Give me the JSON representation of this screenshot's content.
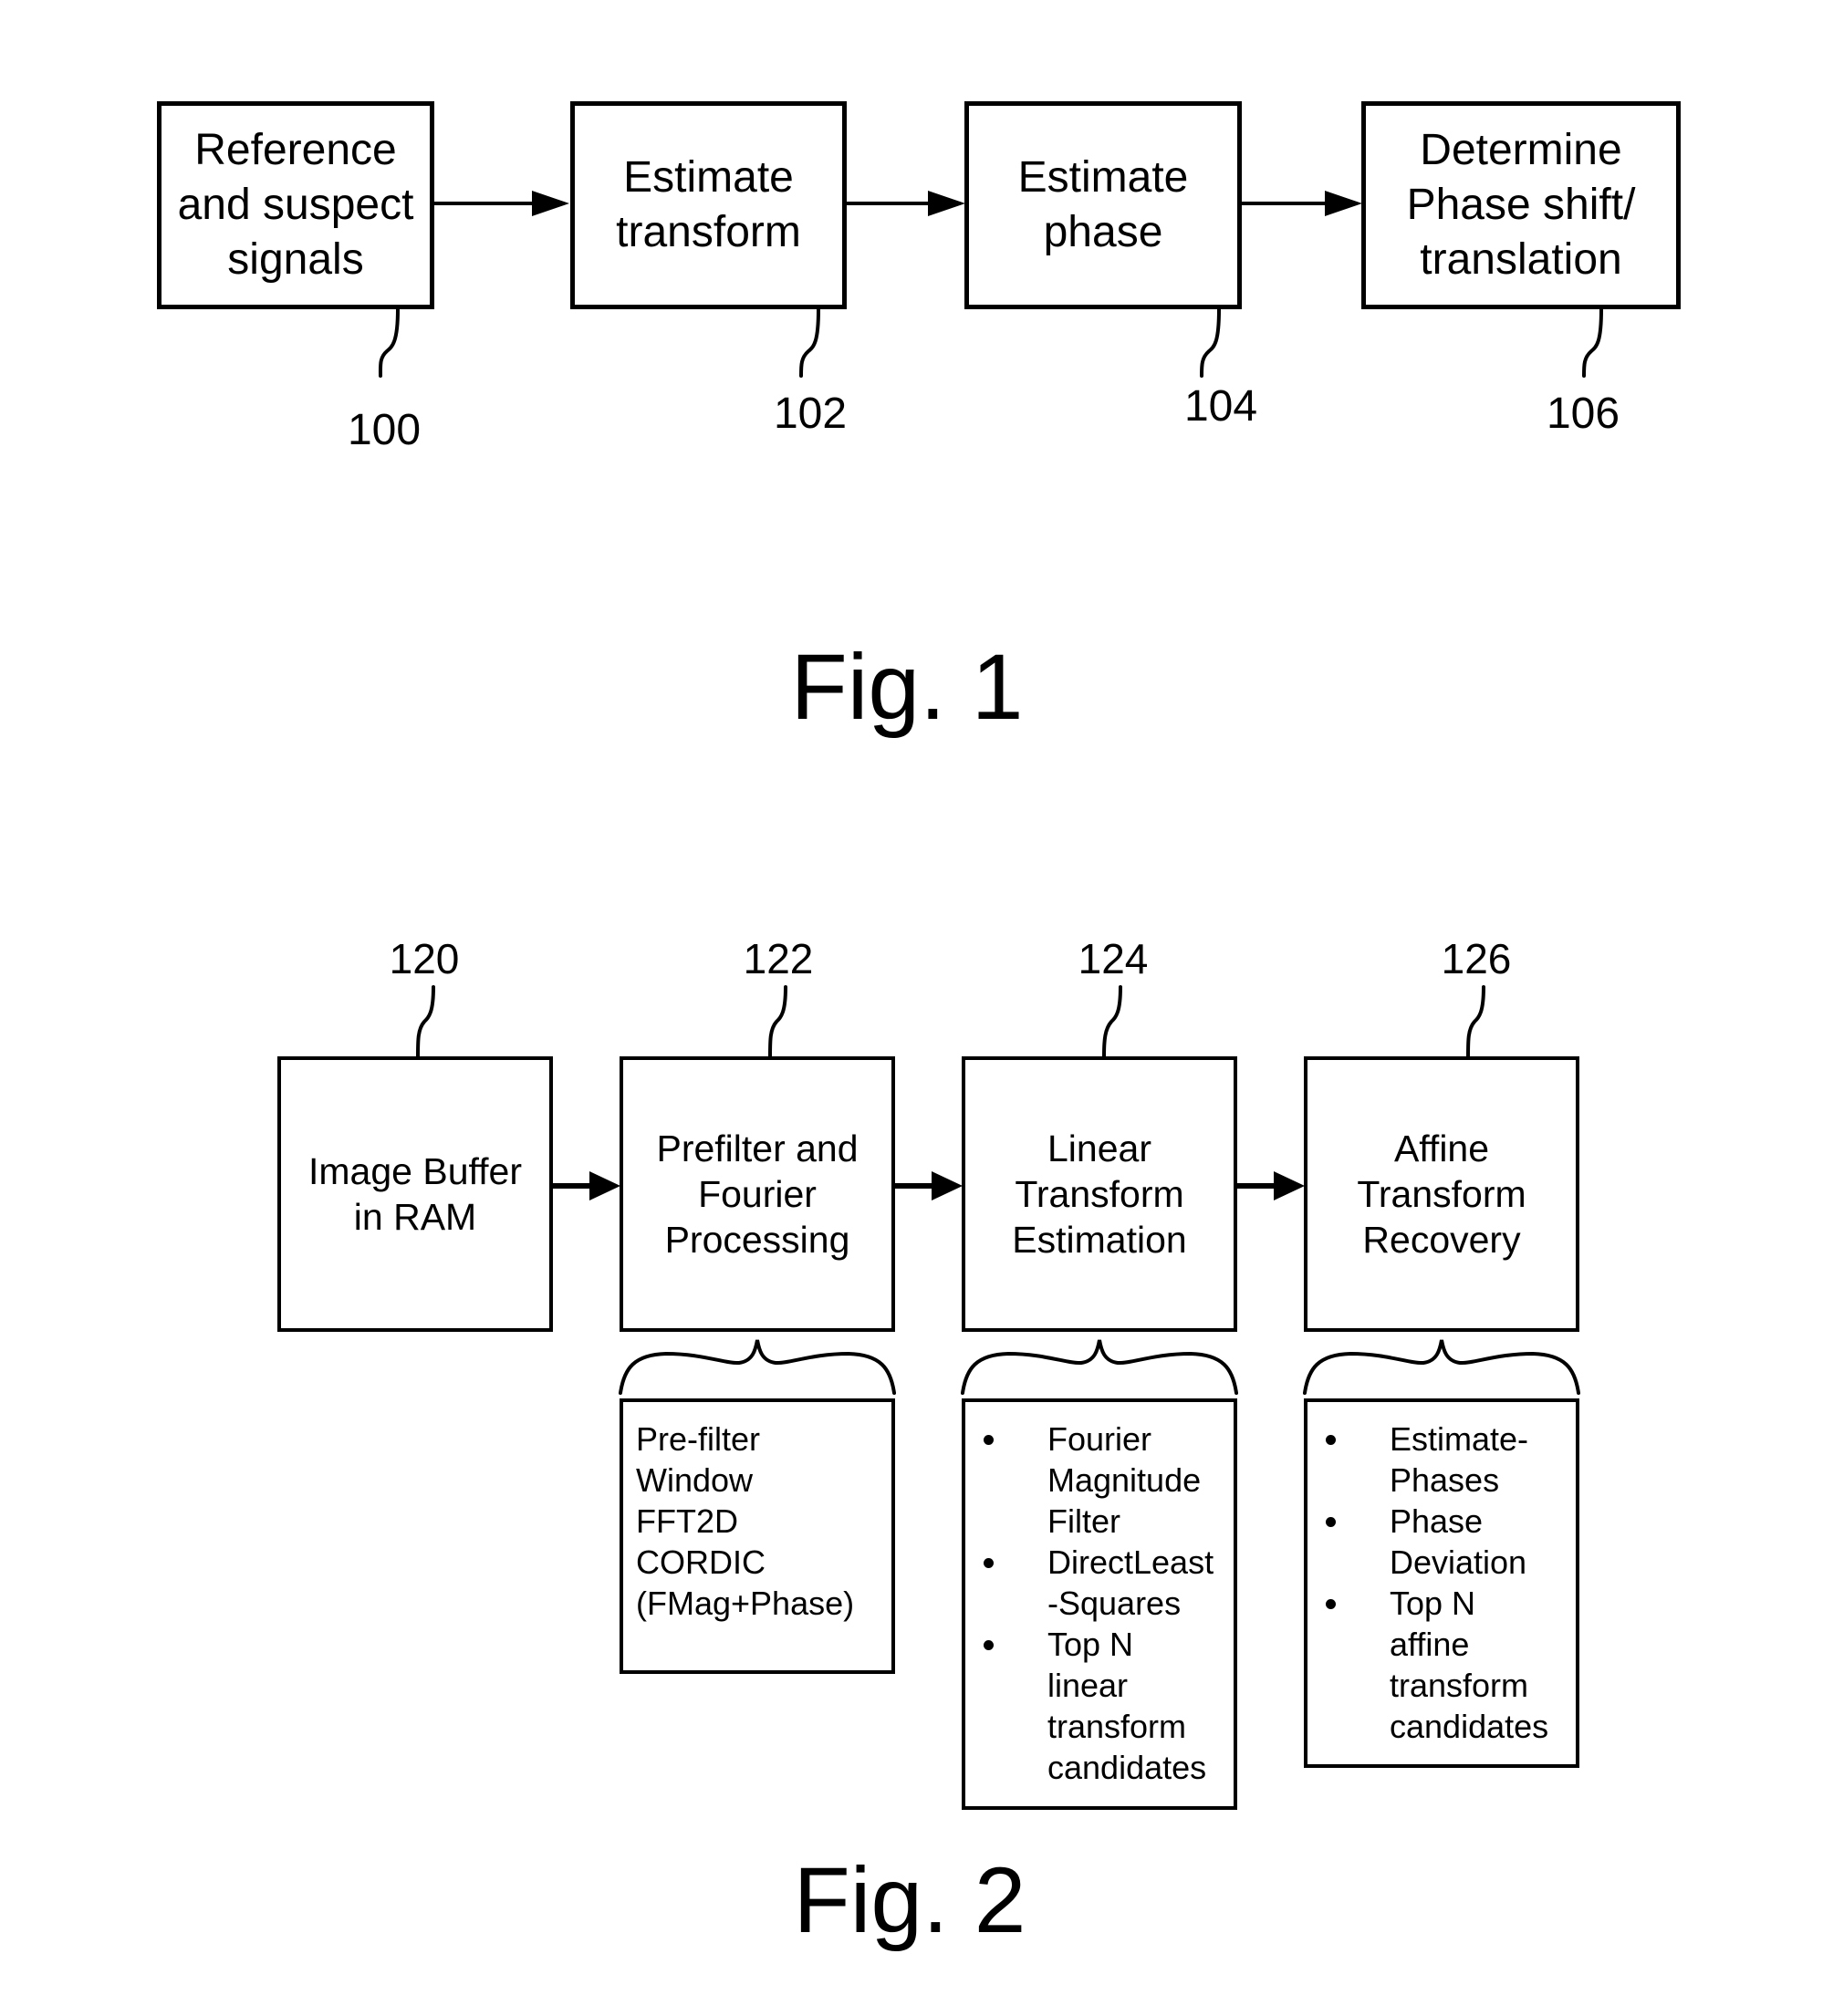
{
  "fig1": {
    "caption": "Fig. 1",
    "blocks": [
      {
        "ref": "100",
        "lines": [
          "Reference",
          "and suspect",
          "signals"
        ]
      },
      {
        "ref": "102",
        "lines": [
          "Estimate",
          "transform"
        ]
      },
      {
        "ref": "104",
        "lines": [
          "Estimate",
          "phase"
        ]
      },
      {
        "ref": "106",
        "lines": [
          "Determine",
          "Phase shift/",
          "translation"
        ]
      }
    ]
  },
  "fig2": {
    "caption": "Fig. 2",
    "blocks": [
      {
        "ref": "120",
        "lines": [
          "Image Buffer",
          "in RAM"
        ]
      },
      {
        "ref": "122",
        "lines": [
          "Prefilter and",
          "Fourier",
          "Processing"
        ]
      },
      {
        "ref": "124",
        "lines": [
          "Linear",
          "Transform",
          "Estimation"
        ]
      },
      {
        "ref": "126",
        "lines": [
          "Affine",
          "Transform",
          "Recovery"
        ]
      }
    ],
    "details": {
      "prefilter": {
        "lines": [
          "Pre-filter",
          "Window",
          "FFT2D",
          "CORDIC",
          "(FMag+Phase)"
        ]
      },
      "linear": {
        "items": [
          {
            "lines": [
              "Fourier",
              "Magnitude",
              "Filter"
            ]
          },
          {
            "lines": [
              "DirectLeast",
              "-Squares"
            ]
          },
          {
            "lines": [
              "Top N",
              "linear",
              "transform",
              "candidates"
            ]
          }
        ]
      },
      "affine": {
        "items": [
          {
            "lines": [
              "Estimate-",
              "Phases"
            ]
          },
          {
            "lines": [
              "Phase",
              "Deviation"
            ]
          },
          {
            "lines": [
              "Top N",
              "affine",
              "transform",
              "candidates"
            ]
          }
        ]
      }
    }
  }
}
